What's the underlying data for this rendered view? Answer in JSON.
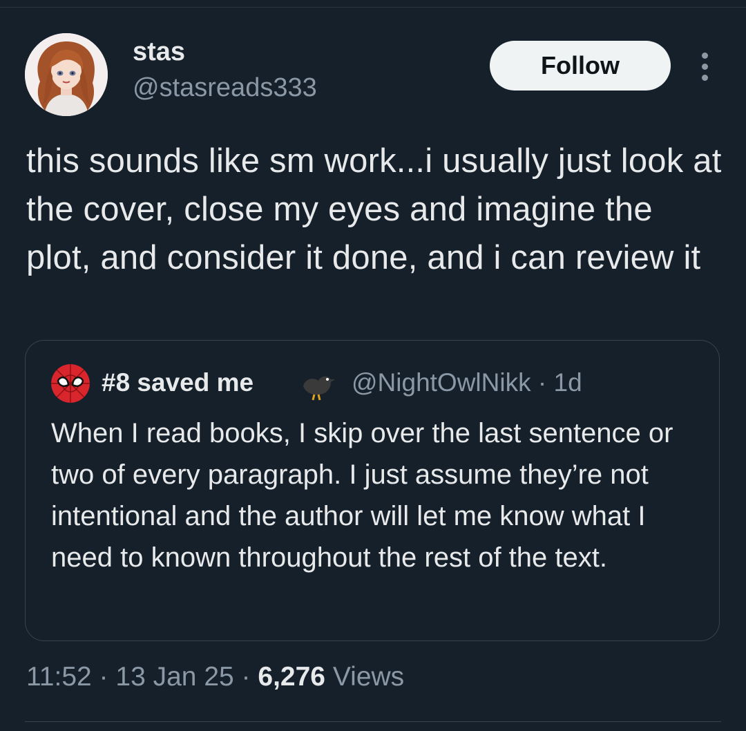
{
  "tweet": {
    "author": {
      "name": "stas",
      "handle": "@stasreads333"
    },
    "follow_label": "Follow",
    "text": "this sounds like sm work...i usually just look at the cover, close my eyes and imagine the plot, and consider it done, and i can review it",
    "time": "11:52",
    "date": "13 Jan 25",
    "views_count": "6,276",
    "views_label": "Views",
    "separator": "·"
  },
  "quoted": {
    "name": "#8 saved me",
    "handle": "@NightOwlNikk",
    "age": "1d",
    "text": "When I read books, I skip over the last sentence or two of every paragraph. I just assume they’re not intentional and the author will let me know what I need to known throughout the rest of the text."
  },
  "icons": {
    "avatar": "avatar-illustration-redhead",
    "quoted_avatar": "spider-mask-icon",
    "bird": "bird-emoji-icon",
    "more": "more-vertical-icon"
  },
  "colors": {
    "background": "#15202b",
    "text_primary": "#e7e9ea",
    "text_secondary": "#8b98a5",
    "border": "#38444d",
    "button_bg": "#eff3f4"
  }
}
